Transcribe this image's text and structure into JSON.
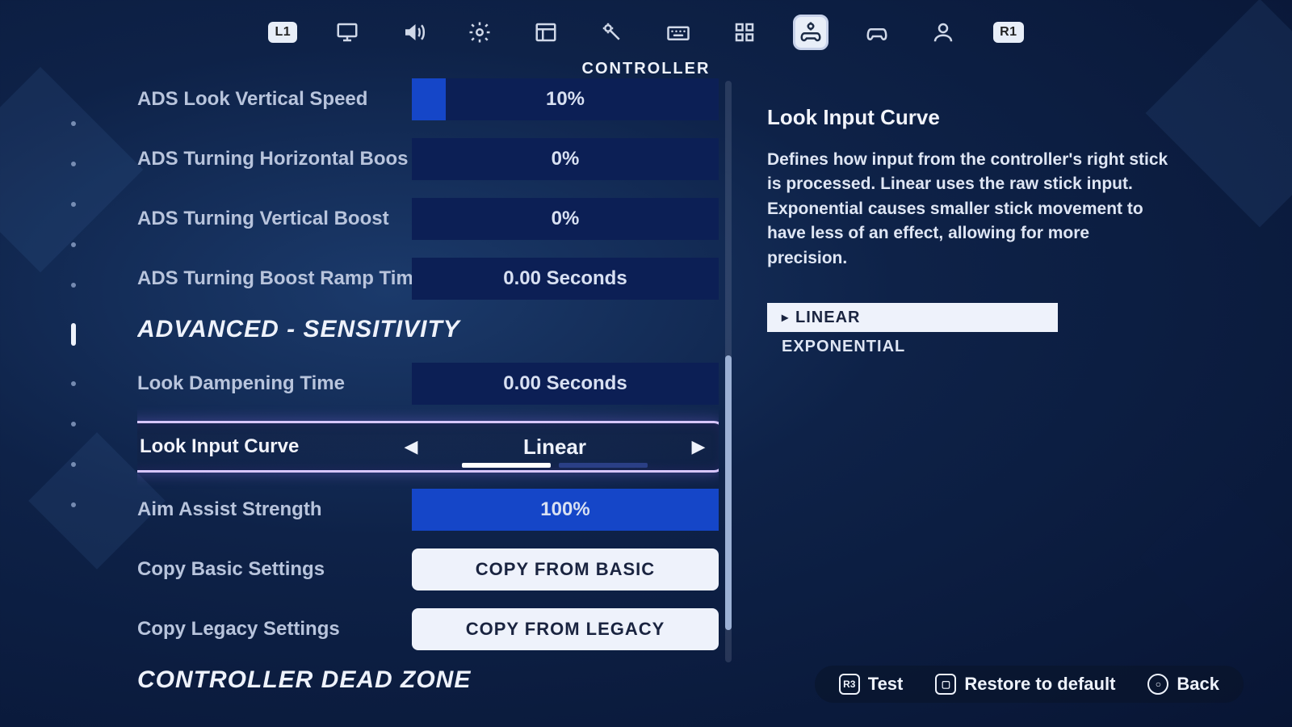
{
  "bumpers": {
    "left": "L1",
    "right": "R1"
  },
  "active_tab_caption": "CONTROLLER",
  "settings": {
    "ads_look_vertical_speed": {
      "label": "ADS Look Vertical Speed",
      "value": "10%"
    },
    "ads_turning_horizontal_boost": {
      "label": "ADS Turning Horizontal Boos",
      "value": "0%"
    },
    "ads_turning_vertical_boost": {
      "label": "ADS Turning Vertical Boost",
      "value": "0%"
    },
    "ads_turning_boost_ramp_time": {
      "label": "ADS Turning Boost Ramp Tim",
      "value": "0.00 Seconds"
    },
    "section_advanced": "ADVANCED - SENSITIVITY",
    "look_dampening_time": {
      "label": "Look Dampening Time",
      "value": "0.00 Seconds"
    },
    "look_input_curve": {
      "label": "Look Input Curve",
      "value": "Linear"
    },
    "aim_assist_strength": {
      "label": "Aim Assist Strength",
      "value": "100%"
    },
    "copy_basic": {
      "label": "Copy Basic Settings",
      "button": "COPY FROM BASIC"
    },
    "copy_legacy": {
      "label": "Copy Legacy Settings",
      "button": "COPY FROM LEGACY"
    },
    "section_deadzone": "CONTROLLER DEAD ZONE"
  },
  "description": {
    "title": "Look Input Curve",
    "body": "Defines how input from the controller's right stick is processed.  Linear uses the raw stick input.  Exponential causes smaller stick movement to have less of an effect, allowing for more precision.",
    "options": {
      "linear": "LINEAR",
      "exponential": "EXPONENTIAL"
    }
  },
  "footer": {
    "test": "Test",
    "restore": "Restore to default",
    "back": "Back"
  }
}
